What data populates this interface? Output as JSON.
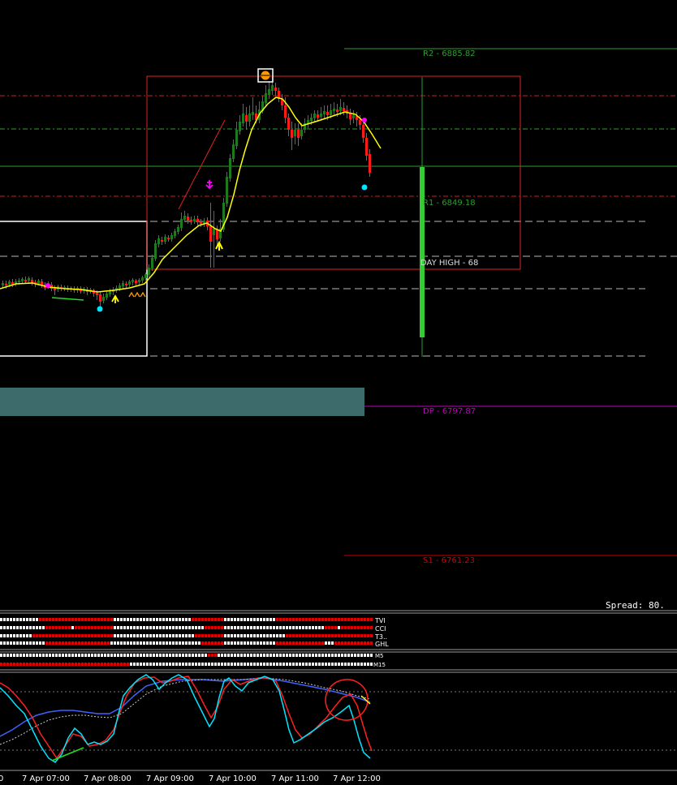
{
  "colors": {
    "background": "#000000",
    "bull": "#1e7b1e",
    "bear": "#ff1a1a",
    "ma": "#ffff00",
    "pivot_r": "#2f9c2f",
    "pivot_s": "#cc0000",
    "pivot_dp": "#c000c0",
    "dashed": "#b0b0b0",
    "zone": "#3d6b6b",
    "cyan": "#00e5ff",
    "magenta": "#ff00ff"
  },
  "chart_data": {
    "type": "candlestick",
    "pivot_levels": [
      {
        "name": "R2",
        "value": 6885.82,
        "label": "R2 - 6885.82"
      },
      {
        "name": "R1",
        "value": 6849.18,
        "label": "R1 - 6849.18"
      },
      {
        "name": "DP",
        "value": 6797.87,
        "label": "DP - 6797.87"
      },
      {
        "name": "S1",
        "value": 6761.23,
        "label": "S1 - 6761.23"
      }
    ],
    "day_high_label": "DAY HIGH - 68",
    "spread_label": "Spread: 80.",
    "time_labels": [
      "0",
      "7 Apr 07:00",
      "7 Apr 08:00",
      "7 Apr 09:00",
      "7 Apr 10:00",
      "7 Apr 11:00",
      "7 Apr 12:00"
    ],
    "indicator_rows": [
      "TVI",
      "CCI",
      "T3..",
      "GHL"
    ],
    "mtf_rows": [
      "M5",
      "M15"
    ]
  }
}
